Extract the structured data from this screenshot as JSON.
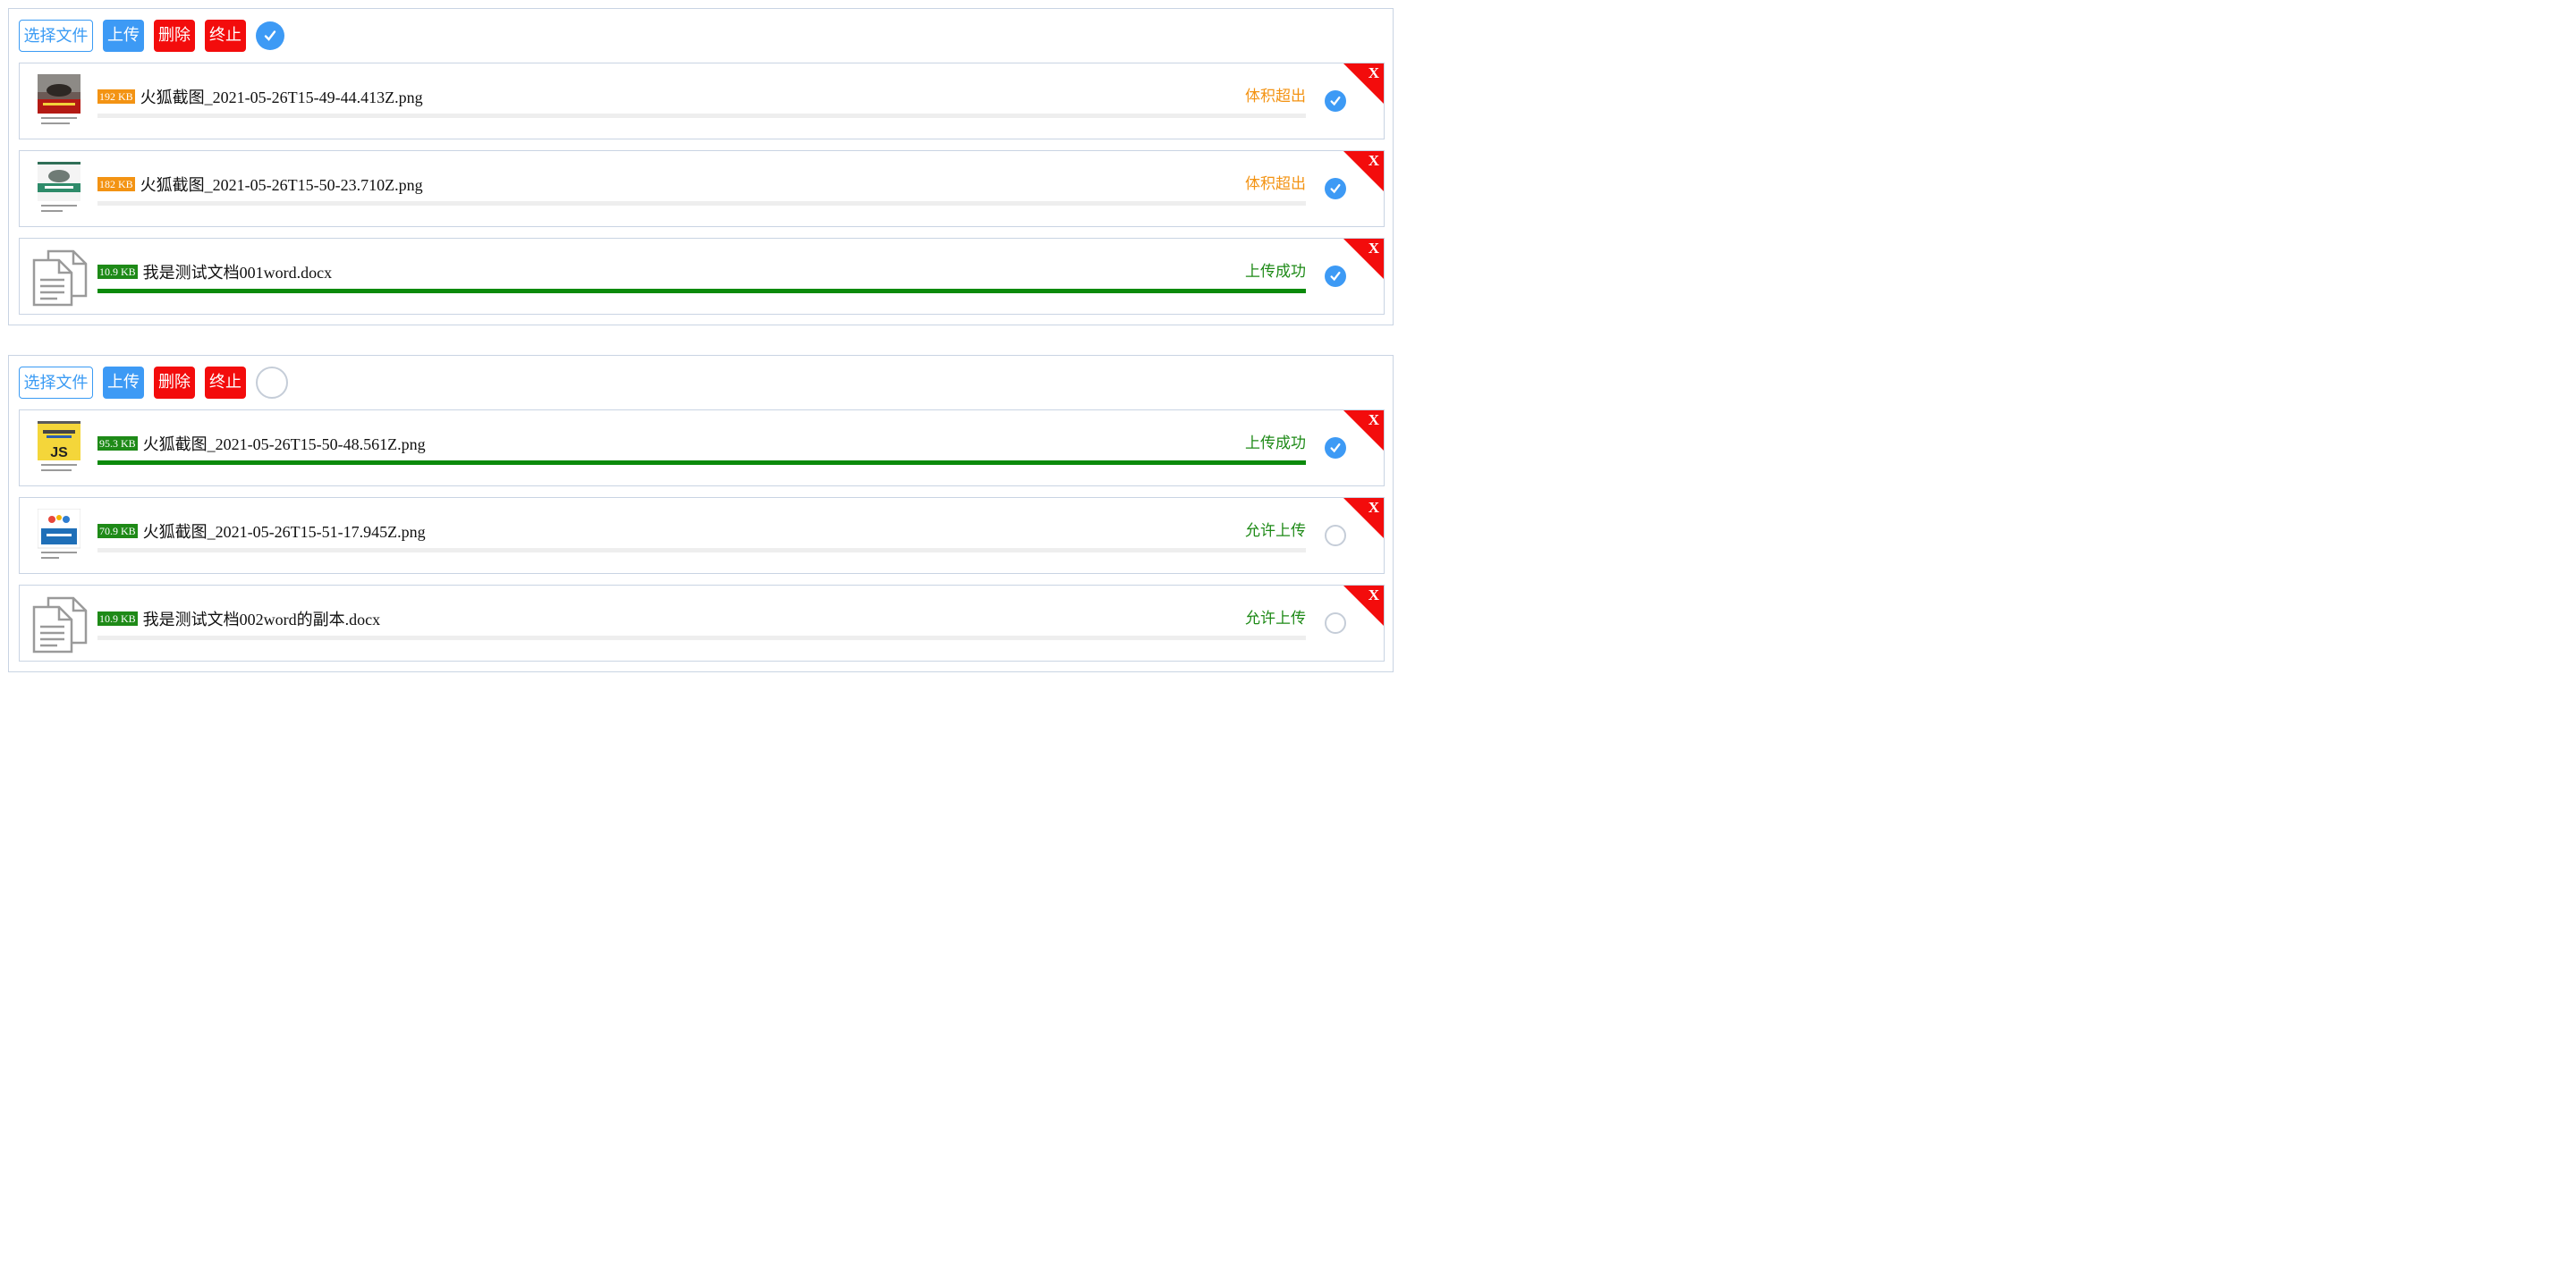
{
  "panels": [
    {
      "toolbar": {
        "choose": "选择文件",
        "upload": "上传",
        "delete": "删除",
        "stop": "终止",
        "select_all_checked": true
      },
      "items": [
        {
          "size": "192 KB",
          "size_color": "#f39313",
          "name": "火狐截图_2021-05-26T15-49-44.413Z.png",
          "status": "体积超出",
          "status_color": "#f39313",
          "progress": 0,
          "checked": true,
          "thumb": "book-cover-red",
          "remove": "X"
        },
        {
          "size": "182 KB",
          "size_color": "#f39313",
          "name": "火狐截图_2021-05-26T15-50-23.710Z.png",
          "status": "体积超出",
          "status_color": "#f39313",
          "progress": 0,
          "checked": true,
          "thumb": "book-cover-rhino",
          "remove": "X"
        },
        {
          "size": "10.9 KB",
          "size_color": "#1e8a17",
          "name": "我是测试文档001word.docx",
          "status": "上传成功",
          "status_color": "#1e8a17",
          "progress": 1,
          "checked": true,
          "thumb": "document-icon",
          "remove": "X"
        }
      ]
    },
    {
      "toolbar": {
        "choose": "选择文件",
        "upload": "上传",
        "delete": "删除",
        "stop": "终止",
        "select_all_checked": false
      },
      "items": [
        {
          "size": "95.3 KB",
          "size_color": "#1e8a17",
          "name": "火狐截图_2021-05-26T15-50-48.561Z.png",
          "status": "上传成功",
          "status_color": "#1e8a17",
          "progress": 1,
          "checked": true,
          "thumb": "book-cover-js",
          "remove": "X"
        },
        {
          "size": "70.9 KB",
          "size_color": "#1e8a17",
          "name": "火狐截图_2021-05-26T15-51-17.945Z.png",
          "status": "允许上传",
          "status_color": "#1e8a17",
          "progress": 0,
          "checked": false,
          "thumb": "book-cover-react",
          "remove": "X"
        },
        {
          "size": "10.9 KB",
          "size_color": "#1e8a17",
          "name": "我是测试文档002word的副本.docx",
          "status": "允许上传",
          "status_color": "#1e8a17",
          "progress": 0,
          "checked": false,
          "thumb": "document-icon",
          "remove": "X"
        }
      ]
    }
  ]
}
